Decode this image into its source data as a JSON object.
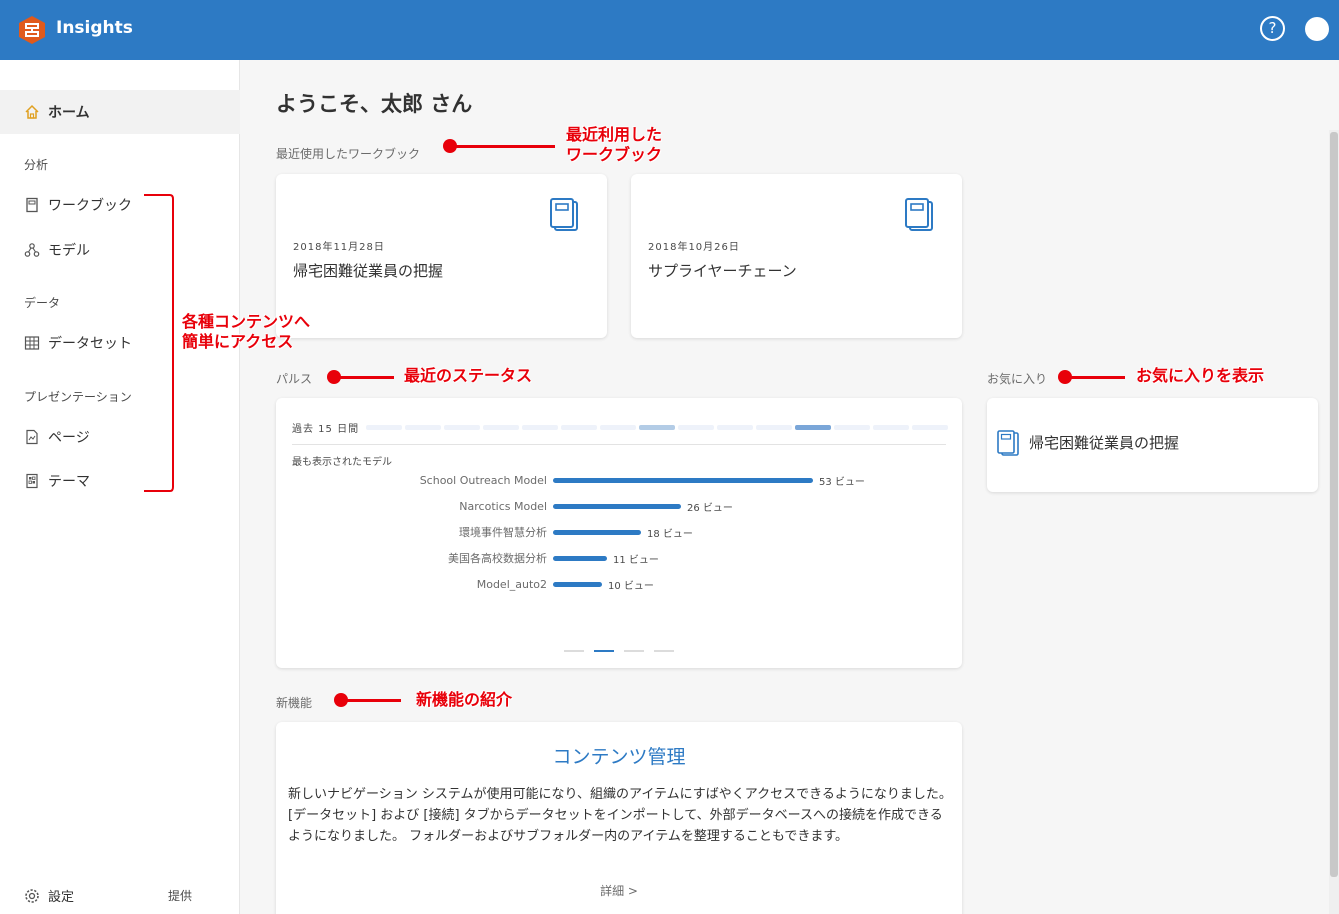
{
  "header": {
    "app_title": "Insights",
    "help_glyph": "?"
  },
  "sidebar": {
    "home_label": "ホーム",
    "section_analysis": "分析",
    "workbook_label": "ワークブック",
    "model_label": "モデル",
    "section_data": "データ",
    "dataset_label": "データセット",
    "section_presentation": "プレゼンテーション",
    "page_label": "ページ",
    "theme_label": "テーマ",
    "settings_label": "設定",
    "provided_label": "提供"
  },
  "main": {
    "welcome": "ようこそ、太郎 さん",
    "recent_label": "最近使用したワークブック",
    "recent_workbooks": [
      {
        "date": "2018年11月28日",
        "name": "帰宅困難従業員の把握"
      },
      {
        "date": "2018年10月26日",
        "name": "サプライヤーチェーン"
      }
    ],
    "pulse_label": "パルス",
    "pulse": {
      "period": "過去 15 日間",
      "timeline_levels": [
        0,
        0,
        0,
        0,
        0,
        0,
        0,
        1,
        0,
        0,
        0,
        2,
        0,
        0,
        0
      ],
      "most_viewed_label": "最も表示されたモデル",
      "models": [
        {
          "name": "School Outreach Model",
          "views": 53,
          "views_label": "53 ビュー"
        },
        {
          "name": "Narcotics Model",
          "views": 26,
          "views_label": "26 ビュー"
        },
        {
          "name": "環境事件智慧分析",
          "views": 18,
          "views_label": "18 ビュー"
        },
        {
          "name": "美国各高校数据分析",
          "views": 11,
          "views_label": "11 ビュー"
        },
        {
          "name": "Model_auto2",
          "views": 10,
          "views_label": "10 ビュー"
        }
      ],
      "pages": 4,
      "active_page": 2
    },
    "favorites_label": "お気に入り",
    "favorites": [
      {
        "name": "帰宅困難従業員の把握"
      }
    ],
    "new_label": "新機能",
    "whats_new": {
      "title": "コンテンツ管理",
      "body": "新しいナビゲーション システムが使用可能になり、組織のアイテムにすばやくアクセスできるようになりました。[データセット] および [接続] タブからデータセットをインポートして、外部データベースへの接続を作成できるようになりました。 フォルダーおよびサブフォルダー内のアイテムを整理することもできます。",
      "more": "詳細 >"
    }
  },
  "annotations": {
    "recent_line1": "最近利用した",
    "recent_line2": "ワークブック",
    "sidebar_line1": "各種コンテンツへ",
    "sidebar_line2": "簡単にアクセス",
    "pulse": "最近のステータス",
    "favorites": "お気に入りを表示",
    "whats_new": "新機能の紹介"
  },
  "colors": {
    "header_bg": "#2d7ac4",
    "accent": "#2d7ac4",
    "annotation_red": "#e8000a",
    "logo_orange": "#e05a1c"
  },
  "icons": {
    "logo": "insights-logo-icon",
    "help": "help-icon",
    "home": "home-icon",
    "workbook": "workbook-icon",
    "model": "model-icon",
    "dataset": "dataset-table-icon",
    "page": "page-icon",
    "theme": "theme-icon",
    "settings": "gear-icon"
  }
}
